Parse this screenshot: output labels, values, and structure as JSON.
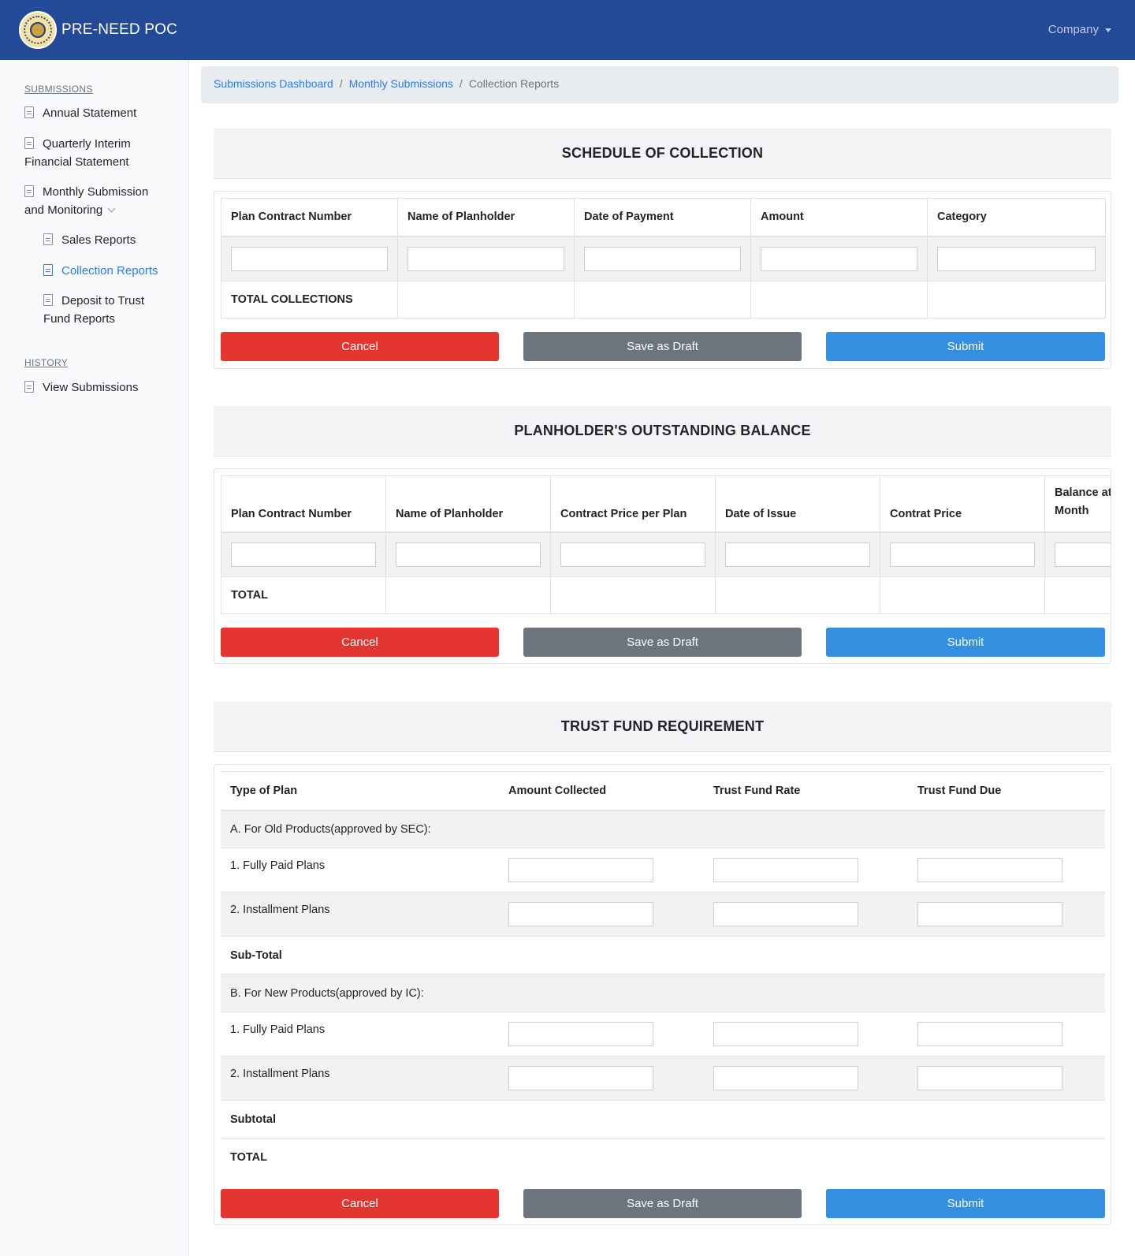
{
  "app": {
    "title": "PRE-NEED POC",
    "company_menu": "Company"
  },
  "sidebar": {
    "submissions_heading": "SUBMISSIONS",
    "annual_statement": "Annual Statement",
    "quarterly_line1": "Quarterly Interim",
    "quarterly_line2": "Financial Statement",
    "monthly_line1": "Monthly Submission",
    "monthly_line2": "and Monitoring",
    "sales_reports": "Sales Reports",
    "collection_reports": "Collection Reports",
    "deposit_line1": "Deposit to Trust",
    "deposit_line2": "Fund Reports",
    "history_heading": "HISTORY",
    "view_submissions": "View Submissions"
  },
  "breadcrumb": {
    "dashboard": "Submissions Dashboard",
    "monthly": "Monthly Submissions",
    "current": "Collection Reports",
    "sep": "/"
  },
  "buttons": {
    "cancel": "Cancel",
    "draft": "Save as Draft",
    "submit": "Submit"
  },
  "schedule": {
    "title": "SCHEDULE OF COLLECTION",
    "headers": [
      "Plan Contract Number",
      "Name of Planholder",
      "Date of Payment",
      "Amount",
      "Category"
    ],
    "total_label": "TOTAL COLLECTIONS"
  },
  "outstanding": {
    "title": "PLANHOLDER'S OUTSTANDING BALANCE",
    "headers": [
      "Plan Contract Number",
      "Name of Planholder",
      "Contract Price per Plan",
      "Date of Issue",
      "Contrat Price"
    ],
    "last_header_line1": "Balance at",
    "last_header_line2": "Month",
    "total_label": "TOTAL"
  },
  "trust": {
    "title": "TRUST FUND REQUIREMENT",
    "headers": [
      "Type of Plan",
      "Amount Collected",
      "Trust Fund Rate",
      "Trust Fund Due"
    ],
    "old_products": "A. For Old Products(approved by SEC):",
    "fully_paid": "1. Fully Paid Plans",
    "installment": "2. Installment Plans",
    "sub_total": "Sub-Total",
    "new_products": "B. For New Products(approved by IC):",
    "subtotal": "Subtotal",
    "total": "TOTAL"
  }
}
